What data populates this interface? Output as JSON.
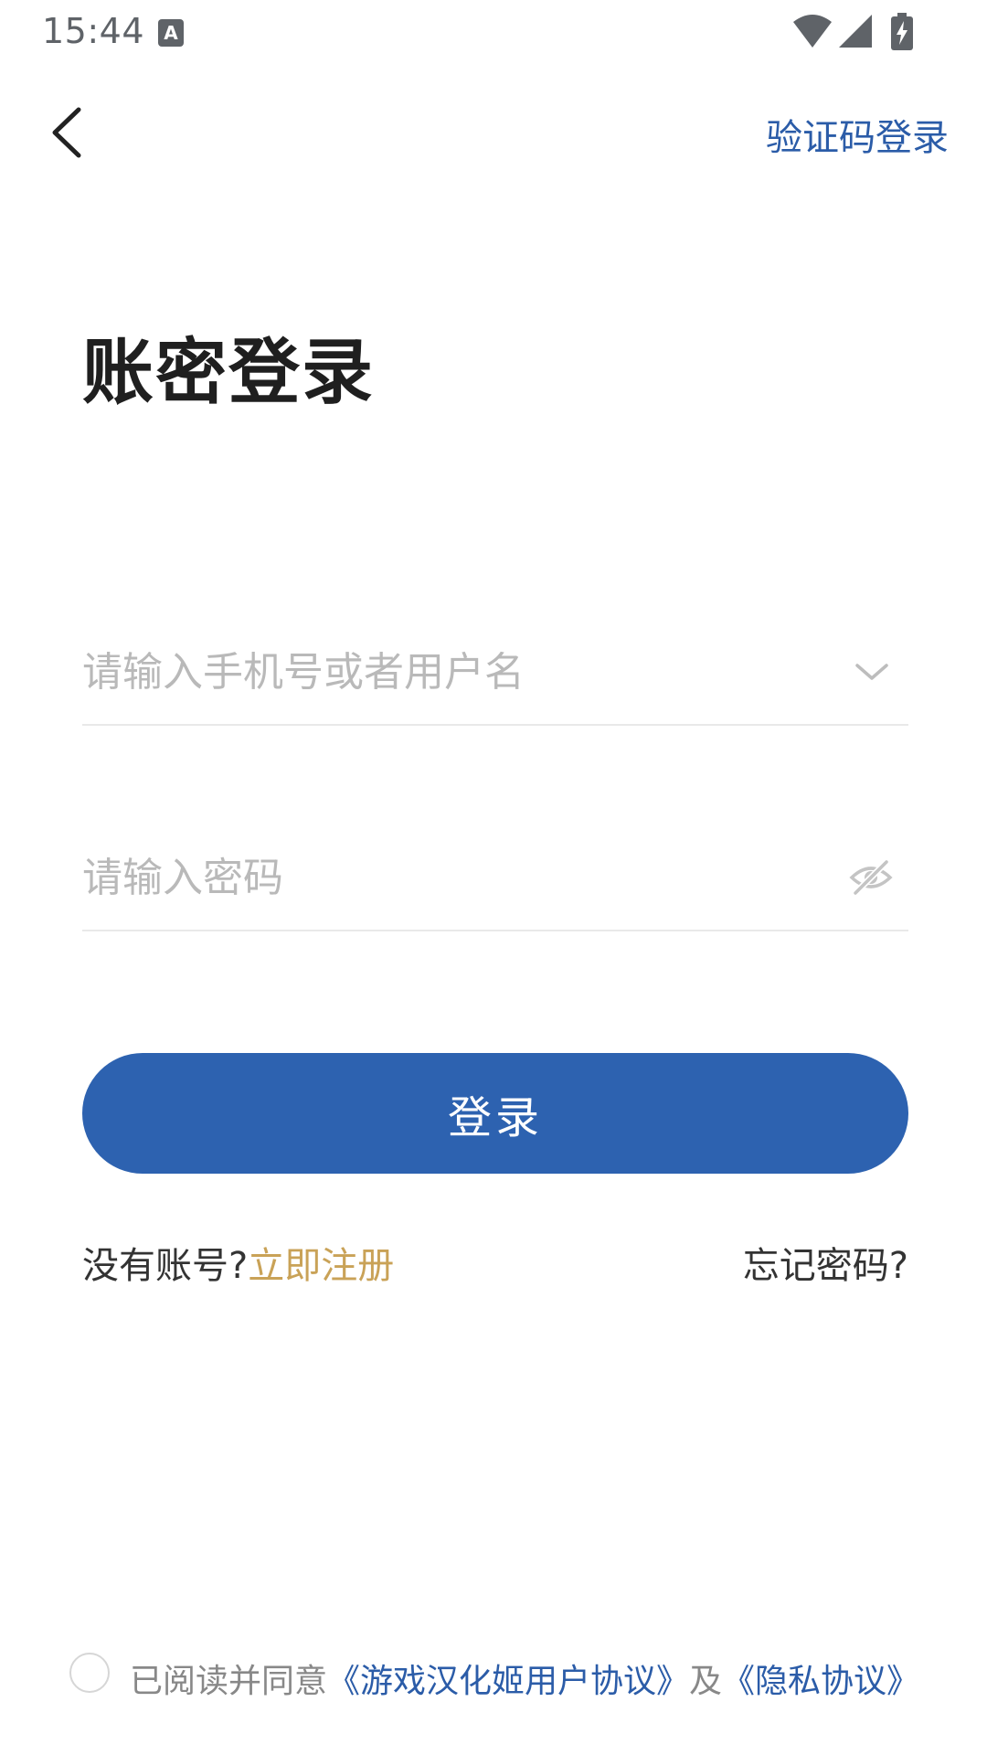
{
  "status_bar": {
    "time": "15:44",
    "icons": [
      "notification-a-icon",
      "wifi-icon",
      "signal-icon",
      "battery-charging-icon"
    ]
  },
  "top_bar": {
    "back_icon": "chevron-left-icon",
    "switch_login_label": "验证码登录"
  },
  "title": "账密登录",
  "username": {
    "placeholder": "请输入手机号或者用户名",
    "value": "",
    "trailing_icon": "chevron-down-icon"
  },
  "password": {
    "placeholder": "请输入密码",
    "value": "",
    "trailing_icon": "eye-off-icon"
  },
  "login_button_label": "登录",
  "register": {
    "prompt": "没有账号?",
    "link": "立即注册"
  },
  "forgot_password_label": "忘记密码?",
  "agreement": {
    "checked": false,
    "prefix": "已阅读并同意",
    "user_agreement": "《游戏汉化姬用户协议》",
    "joiner": "及",
    "privacy_policy": "《隐私协议》"
  },
  "colors": {
    "primary": "#2d62b0",
    "link_blue": "#2b5ca8",
    "register_gold": "#c9a257",
    "placeholder": "#b9b9b9",
    "divider": "#e9e9e9"
  }
}
